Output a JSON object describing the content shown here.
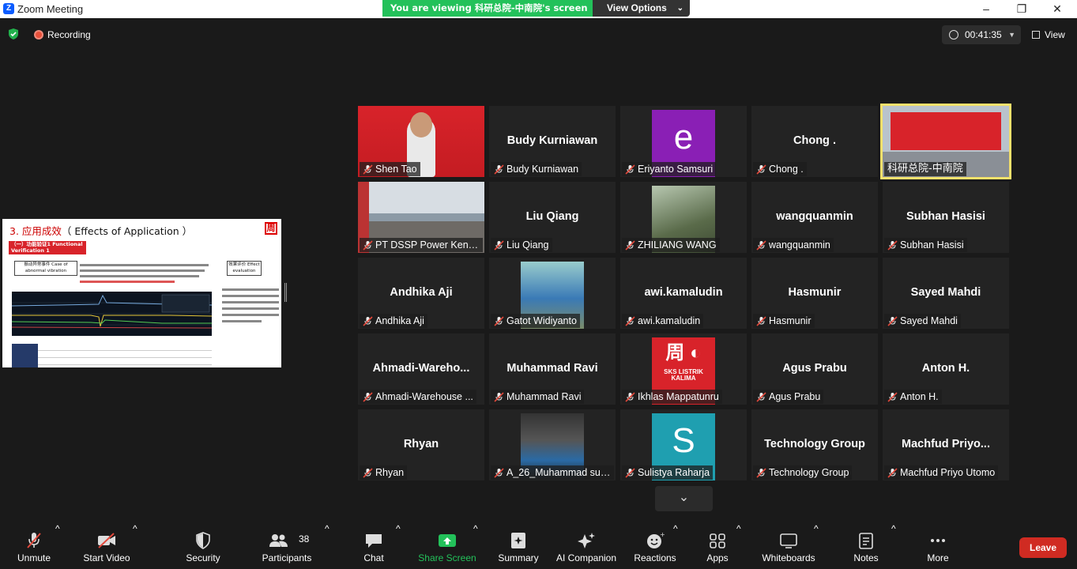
{
  "window": {
    "title": "Zoom Meeting",
    "logo_letter": "Z"
  },
  "banner": {
    "viewing_text": "You are viewing 科研总院-中南院's screen",
    "view_options": "View Options"
  },
  "recording": {
    "label": "Recording"
  },
  "timer": {
    "value": "00:41:35"
  },
  "view_button": {
    "label": "View"
  },
  "shared_screen": {
    "title_prefix": "3. 应用成效",
    "title_suffix": "（ Effects of Application ）",
    "section_label": "（一）功能验证1 Functional Verification 1",
    "left_box": "振动异常事件 Case of abnormal vibration",
    "right_box": "效果评价 Effect evaluation"
  },
  "participants": [
    {
      "id": "shen-tao",
      "name": "Shen Tao",
      "big": "",
      "kind": "video"
    },
    {
      "id": "budy",
      "name": "Budy Kurniawan",
      "big": "Budy Kurniawan",
      "kind": "text"
    },
    {
      "id": "eriyanto",
      "name": "Eriyanto Samsuri",
      "big": "e",
      "kind": "avatar"
    },
    {
      "id": "chong",
      "name": "Chong .",
      "big": "Chong .",
      "kind": "text"
    },
    {
      "id": "kyzy",
      "name": "科研总院-中南院",
      "big": "",
      "kind": "video"
    },
    {
      "id": "pt-dssp",
      "name": "PT DSSP Power Kend...",
      "big": "",
      "kind": "video"
    },
    {
      "id": "liu-qiang",
      "name": "Liu Qiang",
      "big": "Liu Qiang",
      "kind": "text"
    },
    {
      "id": "zhiliang",
      "name": "ZHILIANG WANG",
      "big": "",
      "kind": "photo"
    },
    {
      "id": "wangquanmin",
      "name": "wangquanmin",
      "big": "wangquanmin",
      "kind": "text"
    },
    {
      "id": "subhan",
      "name": "Subhan Hasisi",
      "big": "Subhan Hasisi",
      "kind": "text"
    },
    {
      "id": "andhika",
      "name": "Andhika Aji",
      "big": "Andhika Aji",
      "kind": "text"
    },
    {
      "id": "gatot",
      "name": "Gatot Widiyanto",
      "big": "",
      "kind": "photo"
    },
    {
      "id": "awi",
      "name": "awi.kamaludin",
      "big": "awi.kamaludin",
      "kind": "text"
    },
    {
      "id": "hasmunir",
      "name": "Hasmunir",
      "big": "Hasmunir",
      "kind": "text"
    },
    {
      "id": "sayed",
      "name": "Sayed Mahdi",
      "big": "Sayed Mahdi",
      "kind": "text"
    },
    {
      "id": "ahmadi",
      "name": "Ahmadi-Warehouse ...",
      "big": "Ahmadi-Wareho...",
      "kind": "text"
    },
    {
      "id": "muhammad-ravi",
      "name": "Muhammad Ravi",
      "big": "Muhammad Ravi",
      "kind": "text"
    },
    {
      "id": "ikhlas",
      "name": "Ikhlas Mappatunru",
      "big": "SKS LISTRIK KALIMA",
      "kind": "logo"
    },
    {
      "id": "agus",
      "name": "Agus Prabu",
      "big": "Agus Prabu",
      "kind": "text"
    },
    {
      "id": "anton",
      "name": "Anton H.",
      "big": "Anton H.",
      "kind": "text"
    },
    {
      "id": "rhyan",
      "name": "Rhyan",
      "big": "Rhyan",
      "kind": "text"
    },
    {
      "id": "a26",
      "name": "A_26_Muhammad sufi...",
      "big": "",
      "kind": "photo"
    },
    {
      "id": "sulistya",
      "name": "Sulistya Raharja",
      "big": "S",
      "kind": "avatar"
    },
    {
      "id": "techgroup",
      "name": "Technology Group",
      "big": "Technology Group",
      "kind": "text"
    },
    {
      "id": "machfud",
      "name": "Machfud Priyo Utomo",
      "big": "Machfud  Priyo...",
      "kind": "text"
    }
  ],
  "toolbar": {
    "unmute": "Unmute",
    "start_video": "Start Video",
    "security": "Security",
    "participants": "Participants",
    "participants_count": "38",
    "chat": "Chat",
    "share_screen": "Share Screen",
    "summary": "Summary",
    "ai_companion": "AI Companion",
    "reactions": "Reactions",
    "apps": "Apps",
    "whiteboards": "Whiteboards",
    "notes": "Notes",
    "more": "More",
    "leave": "Leave"
  },
  "colors": {
    "accent_green": "#23c15a",
    "leave_red": "#d02b22",
    "active_speaker": "#f5e16c",
    "avatar_purple": "#8a1fb5",
    "avatar_teal": "#1f9fb0"
  }
}
